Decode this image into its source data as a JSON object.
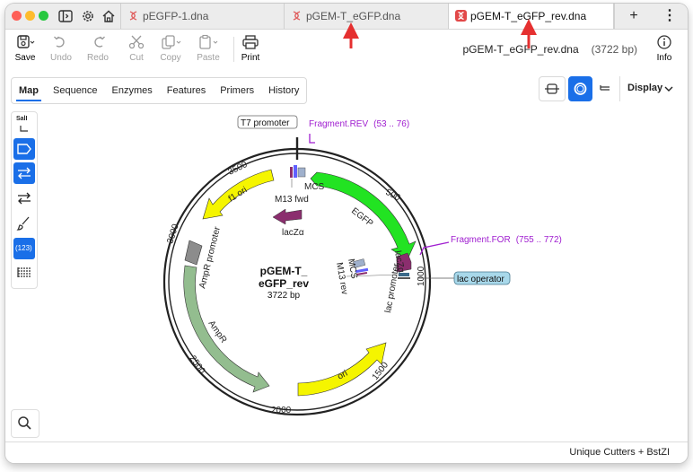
{
  "window": {
    "tabs": [
      {
        "label": "pEGFP-1.dna",
        "active": false
      },
      {
        "label": "pGEM-T_eGFP.dna",
        "active": false
      },
      {
        "label": "pGEM-T_eGFP_rev.dna",
        "active": true
      }
    ],
    "add_tab": "+",
    "menu": "⋮"
  },
  "toolbar": {
    "save": "Save",
    "undo": "Undo",
    "redo": "Redo",
    "cut": "Cut",
    "copy": "Copy",
    "paste": "Paste",
    "print": "Print",
    "info": "Info",
    "file_name": "pGEM-T_eGFP_rev.dna",
    "file_size": "(3722 bp)"
  },
  "view_tabs": [
    "Map",
    "Sequence",
    "Enzymes",
    "Features",
    "Primers",
    "History"
  ],
  "display_button": "Display",
  "left_tools": {
    "sali": "SalI",
    "numbers": "(123)"
  },
  "status": "Unique Cutters + BstZI",
  "map": {
    "name_line1": "pGEM-T_",
    "name_line2": "eGFP_rev",
    "length": "3722 bp",
    "features": {
      "t7": "T7 promoter",
      "mcs_top": "MCS",
      "m13fwd": "M13 fwd",
      "lacz_top": "lacZα",
      "egfp": "EGFP",
      "f1ori": "f1 ori",
      "ampr_prom": "AmpR promoter",
      "ampr": "AmpR",
      "ori": "ori",
      "mcs_inner": "MCS",
      "m13rev": "M13 rev",
      "lac_prom": "lac promoter",
      "lacz_inner": "lacZα",
      "lac_op": "lac operator"
    },
    "fragments": {
      "rev": "Fragment.REV",
      "rev_range": "(53 .. 76)",
      "for": "Fragment.FOR",
      "for_range": "(755 .. 772)"
    },
    "ticks": [
      "500",
      "1000",
      "1500",
      "2000",
      "2500",
      "3000",
      "3500"
    ]
  },
  "colors": {
    "accent": "#1a6fe8",
    "egfp": "#22e322",
    "yellow": "#f5f500",
    "ampr": "#93bd8f",
    "lacz": "#8b2e6e",
    "fragment": "#a01fd0"
  }
}
